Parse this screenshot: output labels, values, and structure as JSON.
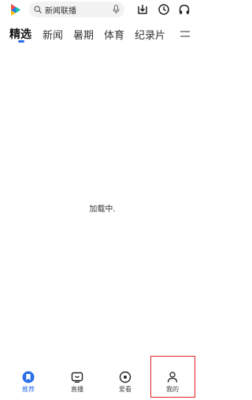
{
  "search": {
    "text": "新闻联播"
  },
  "tabs": [
    {
      "label": "精选"
    },
    {
      "label": "新闻"
    },
    {
      "label": "暑期"
    },
    {
      "label": "体育"
    },
    {
      "label": "纪录片"
    }
  ],
  "main": {
    "loading_text": "加载中."
  },
  "bottom_nav": [
    {
      "label": "推荐",
      "icon": "recommend-icon"
    },
    {
      "label": "直播",
      "icon": "tv-icon"
    },
    {
      "label": "爱看",
      "icon": "eye-icon"
    },
    {
      "label": "我的",
      "icon": "person-icon"
    }
  ],
  "colors": {
    "accent": "#2a6ee8",
    "highlight": "#e02020"
  }
}
